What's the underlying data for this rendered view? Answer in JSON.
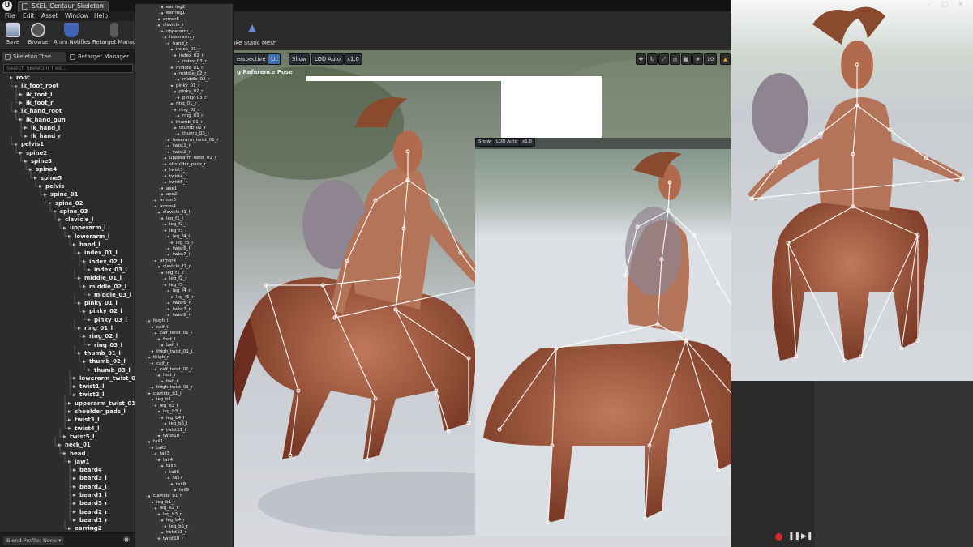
{
  "app": {
    "logo": "U",
    "tab_title": "SKEL_Centaur_Skeleton",
    "tab_close": "✕"
  },
  "menu": [
    "File",
    "Edit",
    "Asset",
    "Window",
    "Help"
  ],
  "toolbar": {
    "save": "Save",
    "browse": "Browse",
    "anim_notifies": "Anim Notifies",
    "retarget": "Retarget Manag",
    "make_static_mesh": "ake Static Mesh"
  },
  "panel": {
    "tab_skeleton_tree": "Skeleton Tree",
    "tab_retarget": "Retarget Manager",
    "search_placeholder": "Search Skeleton Tree...",
    "blend_profile": "Blend Profile: None ▾"
  },
  "bones": [
    {
      "name": "root",
      "depth": 0
    },
    {
      "name": "ik_foot_root",
      "depth": 1
    },
    {
      "name": "ik_foot_l",
      "depth": 2
    },
    {
      "name": "ik_foot_r",
      "depth": 2
    },
    {
      "name": "ik_hand_root",
      "depth": 1
    },
    {
      "name": "ik_hand_gun",
      "depth": 2
    },
    {
      "name": "ik_hand_l",
      "depth": 3
    },
    {
      "name": "ik_hand_r",
      "depth": 3
    },
    {
      "name": "pelvis1",
      "depth": 1
    },
    {
      "name": "spine2",
      "depth": 2
    },
    {
      "name": "spine3",
      "depth": 3
    },
    {
      "name": "spine4",
      "depth": 4
    },
    {
      "name": "spine5",
      "depth": 5
    },
    {
      "name": "pelvis",
      "depth": 6
    },
    {
      "name": "spine_01",
      "depth": 7
    },
    {
      "name": "spine_02",
      "depth": 8
    },
    {
      "name": "spine_03",
      "depth": 9
    },
    {
      "name": "clavicle_l",
      "depth": 10
    },
    {
      "name": "upperarm_l",
      "depth": 11
    },
    {
      "name": "lowerarm_l",
      "depth": 12
    },
    {
      "name": "hand_l",
      "depth": 13
    },
    {
      "name": "index_01_l",
      "depth": 14
    },
    {
      "name": "index_02_l",
      "depth": 15
    },
    {
      "name": "index_03_l",
      "depth": 16
    },
    {
      "name": "middle_01_l",
      "depth": 14
    },
    {
      "name": "middle_02_l",
      "depth": 15
    },
    {
      "name": "middle_03_l",
      "depth": 16
    },
    {
      "name": "pinky_01_l",
      "depth": 14
    },
    {
      "name": "pinky_02_l",
      "depth": 15
    },
    {
      "name": "pinky_03_l",
      "depth": 16
    },
    {
      "name": "ring_01_l",
      "depth": 14
    },
    {
      "name": "ring_02_l",
      "depth": 15
    },
    {
      "name": "ring_03_l",
      "depth": 16
    },
    {
      "name": "thumb_01_l",
      "depth": 14
    },
    {
      "name": "thumb_02_l",
      "depth": 15
    },
    {
      "name": "thumb_03_l",
      "depth": 16
    },
    {
      "name": "lowerarm_twist_01_l",
      "depth": 13
    },
    {
      "name": "twist1_l",
      "depth": 13
    },
    {
      "name": "twist2_l",
      "depth": 13
    },
    {
      "name": "upperarm_twist_01_l",
      "depth": 12
    },
    {
      "name": "shoulder_pads_l",
      "depth": 12
    },
    {
      "name": "twist3_l",
      "depth": 12
    },
    {
      "name": "twist4_l",
      "depth": 12
    },
    {
      "name": "twist5_l",
      "depth": 11
    },
    {
      "name": "neck_01",
      "depth": 10
    },
    {
      "name": "head",
      "depth": 11
    },
    {
      "name": "jaw1",
      "depth": 12
    },
    {
      "name": "beard4",
      "depth": 13
    },
    {
      "name": "beard3_l",
      "depth": 13
    },
    {
      "name": "beard2_l",
      "depth": 13
    },
    {
      "name": "beard1_l",
      "depth": 13
    },
    {
      "name": "beard3_r",
      "depth": 13
    },
    {
      "name": "beard2_r",
      "depth": 13
    },
    {
      "name": "beard1_r",
      "depth": 13
    },
    {
      "name": "earring2",
      "depth": 12
    }
  ],
  "overlay_bones": [
    "earring2",
    "earring1",
    "armor5",
    "clavicle_r",
    "upperarm_r",
    "lowerarm_r",
    "hand_r",
    "index_01_r",
    "index_02_r",
    "index_03_r",
    "middle_01_r",
    "middle_02_r",
    "middle_03_r",
    "pinky_01_r",
    "pinky_02_r",
    "pinky_03_r",
    "ring_01_r",
    "ring_02_r",
    "ring_03_r",
    "thumb_01_r",
    "thumb_02_r",
    "thumb_03_r",
    "lowerarm_twist_01_r",
    "twist1_r",
    "twist2_r",
    "upperarm_twist_01_r",
    "shoulder_pads_r",
    "twist3_r",
    "twist4_r",
    "twist5_r",
    "axe1",
    "axe2",
    "armor3",
    "armor4",
    "clavicle_f1_l",
    "leg_f1_l",
    "leg_f2_l",
    "leg_f3_l",
    "leg_f4_l",
    "leg_f5_l",
    "twist6_l",
    "twist7_l",
    "armor4",
    "clavicle_f1_r",
    "leg_f1_r",
    "leg_f2_r",
    "leg_f3_r",
    "leg_f4_r",
    "leg_f5_r",
    "twist6_r",
    "twist7_r",
    "twist6_r",
    "thigh_l",
    "calf_l",
    "calf_twist_01_l",
    "foot_l",
    "ball_l",
    "thigh_twist_01_l",
    "thigh_r",
    "calf_r",
    "calf_twist_01_r",
    "foot_r",
    "ball_r",
    "thigh_twist_01_r",
    "clavicle_b1_l",
    "leg_b1_l",
    "leg_b2_l",
    "leg_b3_l",
    "leg_b4_l",
    "leg_b5_l",
    "twist11_l",
    "twist10_l",
    "tail1",
    "tail2",
    "tail3",
    "tail4",
    "tail5",
    "tail6",
    "tail7",
    "tail8",
    "tail9",
    "clavicle_b1_r",
    "leg_b1_r",
    "leg_b2_r",
    "leg_b3_r",
    "leg_b4_r",
    "leg_b5_r",
    "twist11_r",
    "twist10_r"
  ],
  "viewport": {
    "perspective": "erspective",
    "lit": "Lit",
    "show": "Show",
    "lod": "LOD Auto",
    "speed": "x1.0",
    "ref_pose": "g Reference Pose",
    "show2": "Show",
    "lod2": "LOD Auto",
    "speed2": "x1.0",
    "grid_value": "10"
  },
  "colors": {
    "accent_blue": "#3c6fb3",
    "record": "#d8282f",
    "warning": "#e0a020"
  }
}
